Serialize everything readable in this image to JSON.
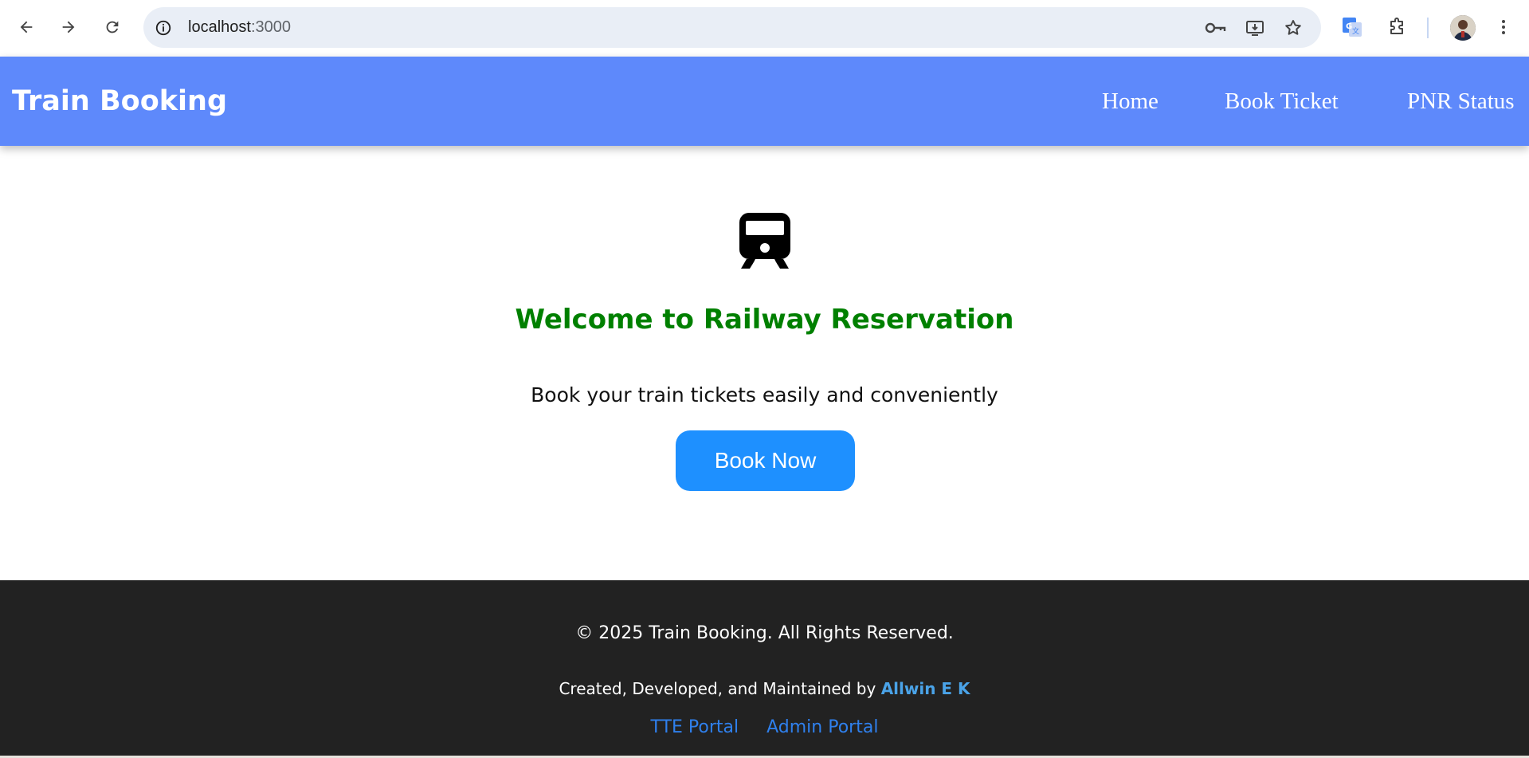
{
  "browser": {
    "url_host": "localhost",
    "url_port": ":3000",
    "icons": [
      "back-icon",
      "forward-icon",
      "reload-icon",
      "site-info-icon",
      "password-key-icon",
      "install-app-icon",
      "bookmark-star-icon",
      "google-translate-icon",
      "extensions-icon",
      "profile-avatar",
      "menu-dots-icon"
    ]
  },
  "header": {
    "brand": "Train Booking",
    "nav": [
      {
        "label": "Home"
      },
      {
        "label": "Book Ticket"
      },
      {
        "label": "PNR Status"
      }
    ],
    "bg_color": "#5e89fb"
  },
  "hero": {
    "icon": "train-icon",
    "title": "Welcome to Railway Reservation",
    "subtitle": "Book your train tickets easily and conveniently",
    "cta_label": "Book Now",
    "title_color": "#008000",
    "cta_color": "#1e90ff"
  },
  "footer": {
    "copyright": "© 2025 Train Booking. All Rights Reserved.",
    "credits_prefix": "Created, Developed, and Maintained by",
    "credits_author": "Allwin E K",
    "links": [
      {
        "label": "TTE Portal"
      },
      {
        "label": "Admin Portal"
      }
    ],
    "bg_color": "#222222"
  }
}
